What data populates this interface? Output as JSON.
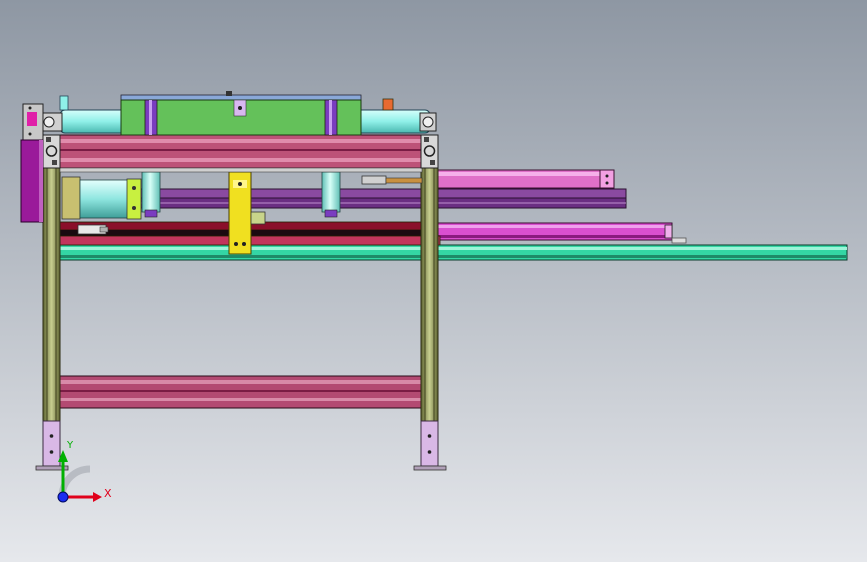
{
  "viewport": {
    "background_top": "#8e97a3",
    "background_bottom": "#e6e8ec"
  },
  "triad": {
    "x_label": "X",
    "y_label": "Y",
    "x_color": "#e0001b",
    "y_color": "#00b000",
    "z_color": "#1a2cf0"
  },
  "part_colors": {
    "cylinder": "#8ff0e8",
    "base_plate": "#64c15a",
    "rail_beam": "#bd5278",
    "magenta_rail": "#d94fd0",
    "green_rail": "#34d6a4",
    "violet_guide": "#7a2aa8",
    "upright": "#9fa66a",
    "yellow_block": "#f0e020",
    "foot_plate": "#d9b8e6",
    "purple_panel": "#9a1a9a"
  }
}
